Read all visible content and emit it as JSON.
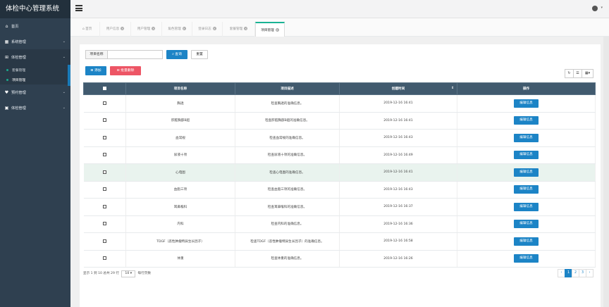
{
  "app": {
    "title": "体检中心管理系统"
  },
  "sidebar": {
    "items": [
      {
        "label": "首页",
        "icon": "home-icon",
        "glyph": "⌂",
        "chevron": false
      },
      {
        "label": "系统管理",
        "icon": "table-icon",
        "glyph": "▦",
        "chevron": true
      },
      {
        "label": "体检管理",
        "icon": "plus-square-icon",
        "glyph": "⊞",
        "chevron": true,
        "expanded": true,
        "children": [
          {
            "label": "套餐管理",
            "current": false
          },
          {
            "label": "项目管理",
            "current": true
          }
        ]
      },
      {
        "label": "预约管理",
        "icon": "heart-icon",
        "glyph": "♥",
        "chevron": true
      },
      {
        "label": "体检管理",
        "icon": "calendar-icon",
        "glyph": "▣",
        "chevron": true
      }
    ]
  },
  "tabs": [
    {
      "label": "首页",
      "icon": "home-icon",
      "closable": false,
      "active": false
    },
    {
      "label": "用户信息",
      "closable": true,
      "active": false
    },
    {
      "label": "用户管理",
      "closable": true,
      "active": false
    },
    {
      "label": "角色管理",
      "closable": true,
      "active": false
    },
    {
      "label": "登录日志",
      "closable": true,
      "active": false
    },
    {
      "label": "套餐管理",
      "closable": true,
      "active": false
    },
    {
      "label": "项目管理",
      "closable": true,
      "active": true
    }
  ],
  "search": {
    "label": "项目名称",
    "value": "",
    "query_label": "查询",
    "reset_label": "重置"
  },
  "actions": {
    "add_label": "添加",
    "batch_delete_label": "批量删除"
  },
  "table": {
    "columns": [
      "项目名称",
      "项目描述",
      "创建时间",
      "操作"
    ],
    "rows": [
      {
        "name": "胸透",
        "desc": "检查胸透的准确信息。",
        "time": "2019-12-16 16:41"
      },
      {
        "name": "肝脏胸部B超",
        "desc": "检查肝脏胸部B超的准确信息。",
        "time": "2019-12-16 16:41"
      },
      {
        "name": "血常规",
        "desc": "检查血常规的准确信息。",
        "time": "2019-12-16 16:43"
      },
      {
        "name": "尿液十项",
        "desc": "检查尿液十项的准确信息。",
        "time": "2019-12-16 16:49"
      },
      {
        "name": "心电图",
        "desc": "检查心电图的准确信息。",
        "time": "2019-12-16 16:41"
      },
      {
        "name": "血脂三项",
        "desc": "检查血脂三项的准确信息。",
        "time": "2019-12-16 16:43"
      },
      {
        "name": "耳鼻喉科",
        "desc": "检查耳鼻喉科的准确信息。",
        "time": "2019-12-16 16:37"
      },
      {
        "name": "内科",
        "desc": "检查内科的准确信息。",
        "time": "2019-12-16 16:36"
      },
      {
        "name": "TDGF（恶性肿瘤特异生长因子）",
        "desc": "检查TDGF（恶性肿瘤特异生长因子）的准确信息。",
        "time": "2019-12-16 16:58"
      },
      {
        "name": "体重",
        "desc": "检查体重的准确信息。",
        "time": "2019-12-16 16:26"
      }
    ],
    "edit_label": "编辑信息",
    "hover_row": 4
  },
  "footer": {
    "summary": "显示 1 到 10 总共 29 行",
    "page_size": "10",
    "per_page_label": "每行页数"
  },
  "pagination": {
    "pages": [
      "‹",
      "1",
      "2",
      "3",
      "›"
    ],
    "current": "1"
  },
  "colors": {
    "sidebar": "#2f4050",
    "header": "#415a6e",
    "primary": "#1c84c6",
    "danger": "#ed5565"
  }
}
